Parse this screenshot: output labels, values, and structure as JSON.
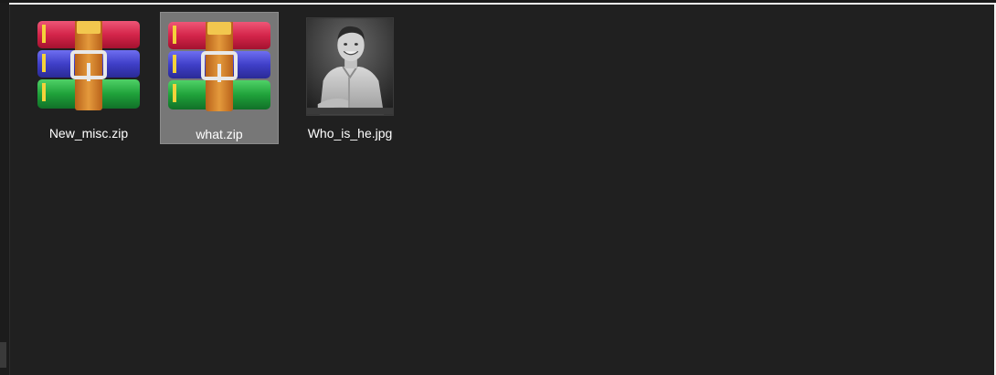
{
  "files": [
    {
      "name": "New_misc.zip",
      "type": "archive",
      "icon": "winrar-archive-icon",
      "selected": false
    },
    {
      "name": "what.zip",
      "type": "archive",
      "icon": "winrar-archive-icon",
      "selected": true
    },
    {
      "name": "Who_is_he.jpg",
      "type": "image",
      "icon": "photo-thumbnail",
      "selected": false
    }
  ],
  "colors": {
    "background": "#202020",
    "selection": "#777777",
    "text": "#ffffff",
    "archive_red": "#d4254a",
    "archive_blue": "#3f3fc8",
    "archive_green": "#1fa13a",
    "strap": "#d98a2b"
  }
}
